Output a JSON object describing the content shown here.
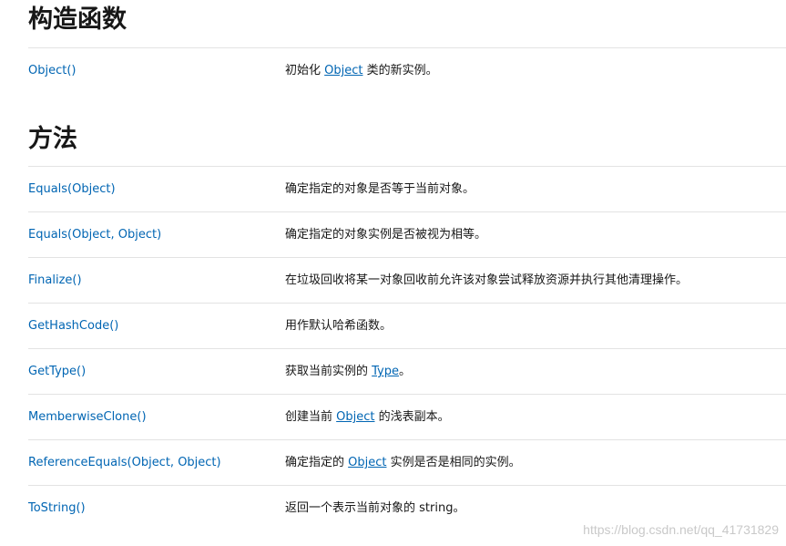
{
  "constructors": {
    "title": "构造函数",
    "rows": [
      {
        "name": "Object()",
        "desc_pre": "初始化 ",
        "desc_link": "Object",
        "desc_post": " 类的新实例。"
      }
    ]
  },
  "methods": {
    "title": "方法",
    "rows": [
      {
        "name": "Equals(Object)",
        "desc_pre": "确定指定的对象是否等于当前对象。",
        "desc_link": "",
        "desc_post": ""
      },
      {
        "name": "Equals(Object, Object)",
        "desc_pre": "确定指定的对象实例是否被视为相等。",
        "desc_link": "",
        "desc_post": ""
      },
      {
        "name": "Finalize()",
        "desc_pre": "在垃圾回收将某一对象回收前允许该对象尝试释放资源并执行其他清理操作。",
        "desc_link": "",
        "desc_post": ""
      },
      {
        "name": "GetHashCode()",
        "desc_pre": "用作默认哈希函数。",
        "desc_link": "",
        "desc_post": ""
      },
      {
        "name": "GetType()",
        "desc_pre": "获取当前实例的 ",
        "desc_link": "Type",
        "desc_post": "。"
      },
      {
        "name": "MemberwiseClone()",
        "desc_pre": "创建当前 ",
        "desc_link": "Object",
        "desc_post": " 的浅表副本。"
      },
      {
        "name": "ReferenceEquals(Object, Object)",
        "desc_pre": "确定指定的 ",
        "desc_link": "Object",
        "desc_post": " 实例是否是相同的实例。"
      },
      {
        "name": "ToString()",
        "desc_pre": "返回一个表示当前对象的 string。",
        "desc_link": "",
        "desc_post": ""
      }
    ]
  },
  "watermark": "https://blog.csdn.net/qq_41731829",
  "colors": {
    "link": "#0065b3",
    "text": "#171717",
    "divider": "#e3e3e3"
  }
}
